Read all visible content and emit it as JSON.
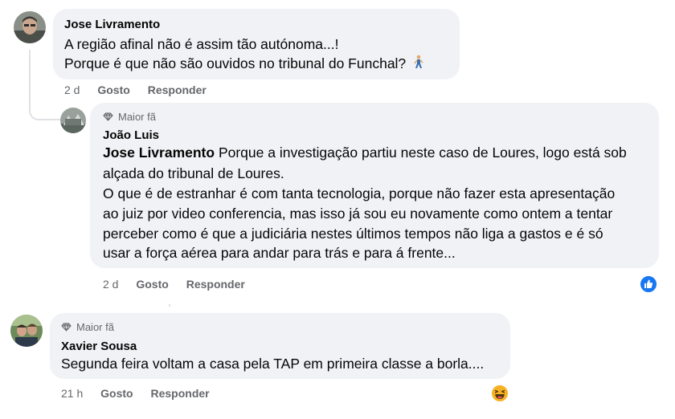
{
  "comments": [
    {
      "author": "Jose Livramento",
      "lines": [
        "A região afinal não é assim tão autónoma...!",
        "Porque é que não são ouvidos no tribunal do Funchal?"
      ],
      "emoji": "walking-person",
      "time": "2 d",
      "like": "Gosto",
      "reply": "Responder"
    },
    {
      "badge": "Maior fã",
      "author": "João Luis",
      "mention": "Jose Livramento",
      "line1": " Porque a investigação partiu neste caso de Loures, logo está sob",
      "rest": [
        "alçada do tribunal de Loures.",
        "O que é de estranhar é com tanta tecnologia, porque não fazer esta apresentação",
        "ao juiz por video conferencia, mas isso já sou eu novamente como ontem a tentar",
        "perceber como é que a judiciária nestes últimos tempos não liga a gastos e é só",
        "usar a força aérea para andar para trás e para á frente..."
      ],
      "time": "2 d",
      "like": "Gosto",
      "reply": "Responder",
      "reaction": "like"
    },
    {
      "badge": "Maior fã",
      "author": "Xavier Sousa",
      "lines": [
        "Segunda feira voltam a casa pela TAP em primeira classe a borla...."
      ],
      "time": "21 h",
      "like": "Gosto",
      "reply": "Responder",
      "reaction": "haha"
    }
  ],
  "colors": {
    "bubble": "#f0f2f5",
    "meta": "#65676b",
    "like_blue": "#1877f2",
    "haha_yellow": "#f7b125"
  }
}
